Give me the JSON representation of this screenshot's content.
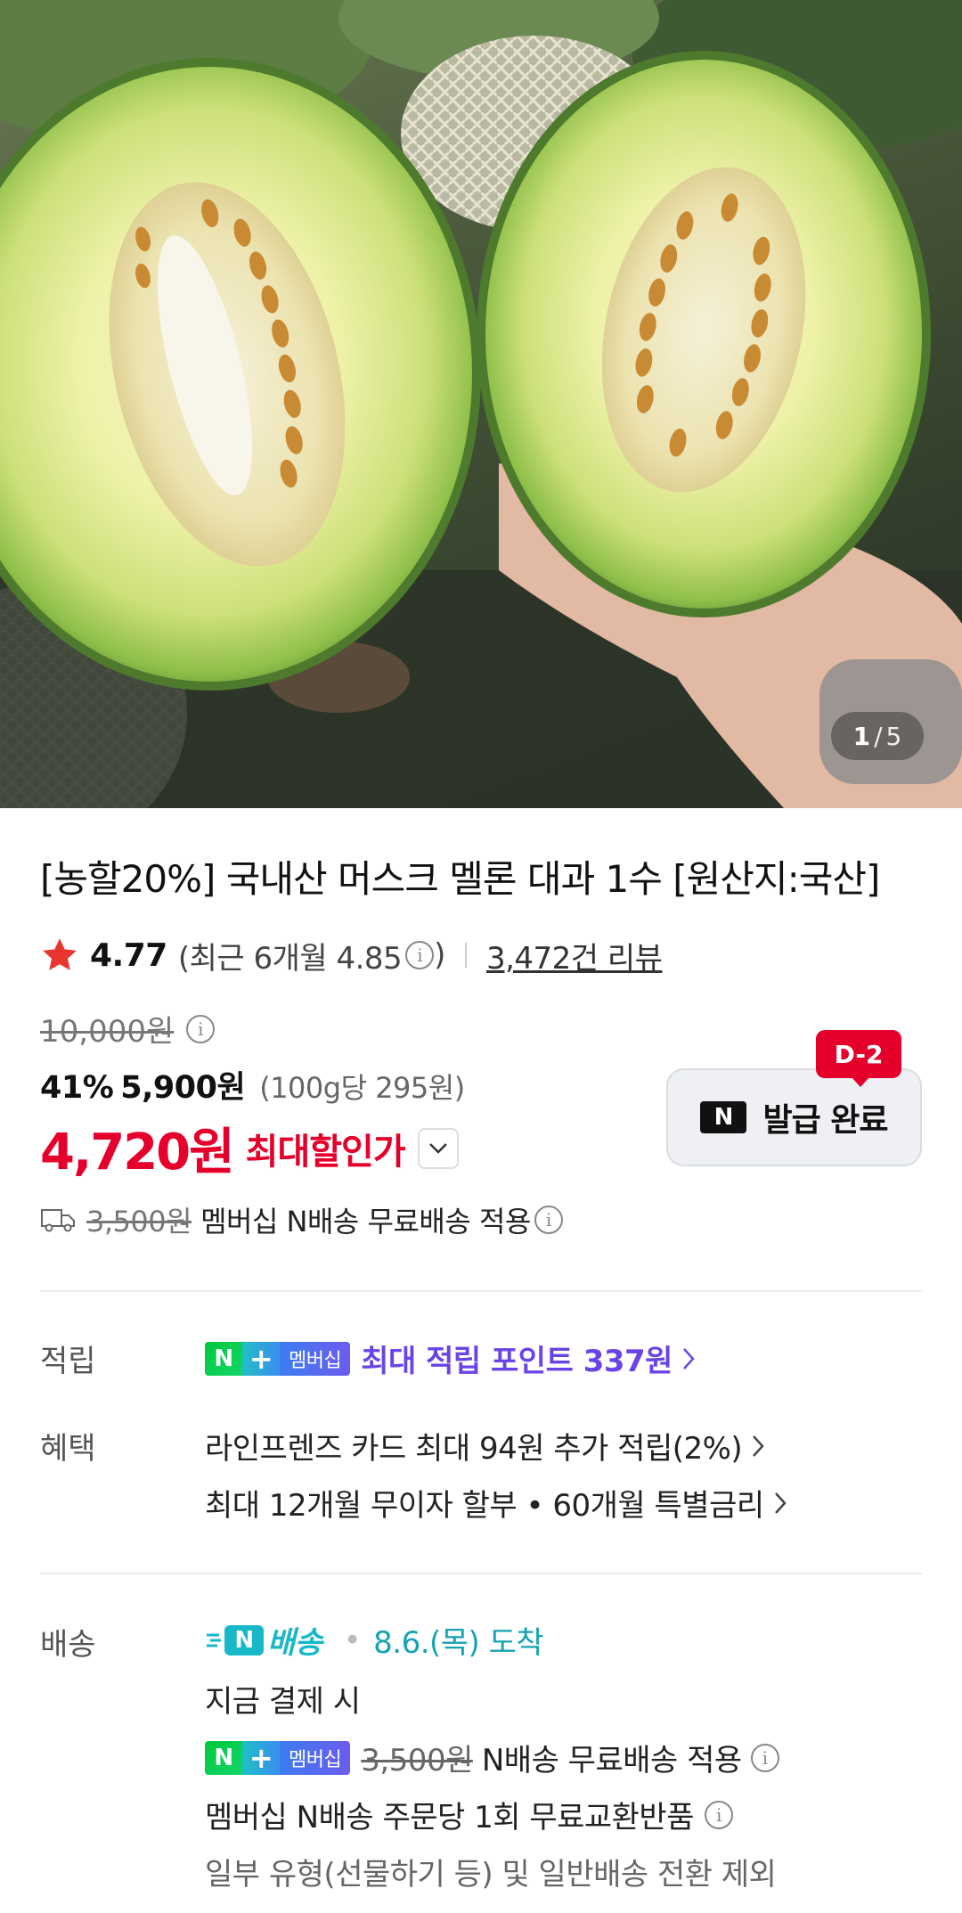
{
  "gallery": {
    "current": "1",
    "separator": "/",
    "total": "5"
  },
  "product": {
    "title": "[농할20%] 국내산 머스크 멜론 대과 1수 [원산지:국산]",
    "rating": "4.77",
    "recent_rating_text": "(최근 6개월 4.85",
    "recent_rating_close": ")",
    "review_count": "3,472건 리뷰"
  },
  "price": {
    "original": "10,000원",
    "discount_pct": "41%",
    "discounted": "5,900원",
    "unit_price": "(100g당 295원)",
    "final_amount": "4,720원",
    "final_label": "최대할인가"
  },
  "coupon": {
    "badge": "D-2",
    "logo": "N",
    "text": "발급 완료"
  },
  "shipping_summary": {
    "old_fee": "3,500원",
    "text": "멤버십 N배송 무료배송 적용"
  },
  "points": {
    "label": "적립",
    "badge_n": "N",
    "badge_plus": "+",
    "badge_member": "멤버십",
    "text": "최대 적립 포인트 337원"
  },
  "benefits": {
    "label": "혜택",
    "card": "라인프렌즈 카드 최대 94원 추가 적립(2%)",
    "installment": "최대 12개월 무이자 할부 • 60개월 특별금리"
  },
  "delivery": {
    "label": "배송",
    "n_logo": "N",
    "n_word": "배송",
    "dot": "•",
    "arrival": "8.6.(목) 도착",
    "pay_now": "지금 결제 시",
    "badge_n": "N",
    "badge_plus": "+",
    "badge_member": "멤버십",
    "old_fee": "3,500원",
    "free_text": "N배송 무료배송 적용",
    "exchange": "멤버십 N배송 주문당 1회 무료교환반품",
    "exclusion": "일부 유형(선물하기 등) 및 일반배송 전환 제외"
  },
  "colors": {
    "accent_red": "#e4002b",
    "points_purple": "#6a44e6",
    "delivery_teal": "#19b8c8"
  },
  "icons": [
    "star-icon",
    "info-icon",
    "chevron-down-icon",
    "truck-icon",
    "chevron-right-icon",
    "n-delivery-icon"
  ]
}
